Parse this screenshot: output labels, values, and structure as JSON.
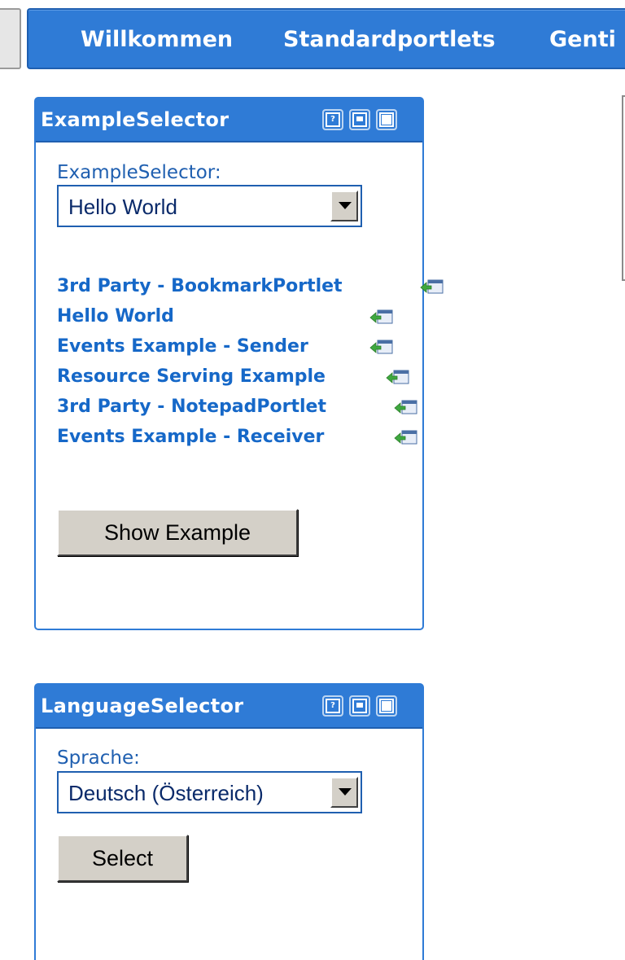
{
  "nav": {
    "items": [
      "Willkommen",
      "Standardportlets",
      "Genti"
    ]
  },
  "example_portlet": {
    "title": "ExampleSelector",
    "select_label": "ExampleSelector:",
    "select_value": "Hello World",
    "links": [
      "3rd Party - BookmarkPortlet",
      "Hello World",
      "Events Example - Sender",
      "Resource Serving Example",
      "3rd Party - NotepadPortlet",
      "Events Example - Receiver"
    ],
    "button_label": "Show Example"
  },
  "language_portlet": {
    "title": "LanguageSelector",
    "select_label": "Sprache:",
    "select_value": "Deutsch (Österreich)",
    "button_label": "Select"
  },
  "window_icons": [
    "help-icon",
    "minimize-icon",
    "maximize-icon"
  ],
  "colors": {
    "accent": "#2f7bd6",
    "link": "#1668c8",
    "button_face": "#d4d0c8"
  }
}
